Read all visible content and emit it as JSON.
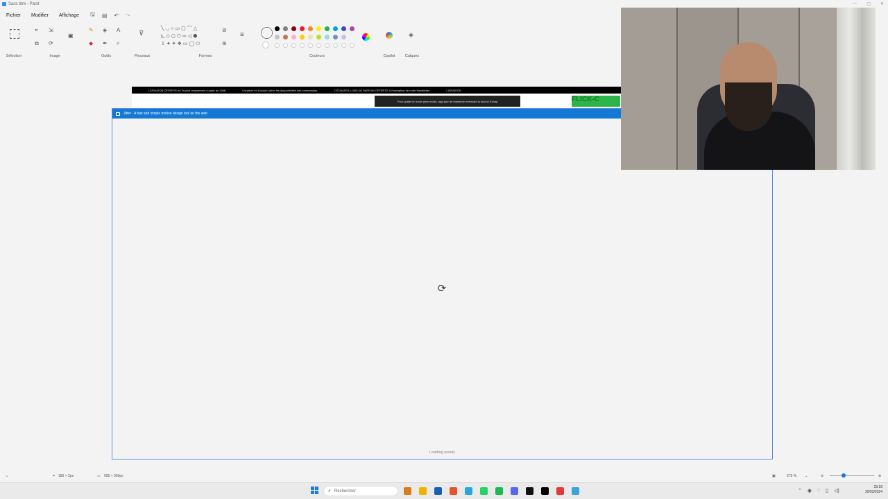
{
  "window": {
    "title": "Sans titre - Paint",
    "controls": [
      "—",
      "▢",
      "✕"
    ]
  },
  "menu": {
    "items": [
      "Fichier",
      "Modifier",
      "Affichage"
    ]
  },
  "ribbon": {
    "groups": [
      "Sélection",
      "Image",
      "Outils",
      "Pinceaux",
      "Formes",
      "Couleurs",
      "Copilot",
      "Calques"
    ],
    "colors_row1": [
      "#000000",
      "#7f7f7f",
      "#880015",
      "#ed1c24",
      "#ff7f27",
      "#fff200",
      "#22b14c",
      "#00a2e8",
      "#3f48cc",
      "#a349a4"
    ],
    "colors_row2": [
      "#c3c3c3",
      "#b97a57",
      "#ffaec9",
      "#ffc90e",
      "#efe4b0",
      "#b5e61d",
      "#99d9ea",
      "#7092be",
      "#c8bfe7"
    ],
    "primary_color": "#000000",
    "accent": "#1478d6"
  },
  "canvas": {
    "banner_text_1": "LIVRAISON OFFERTE en France uniquement à partir de 150€",
    "banner_text_2": "Livraison en Europe: selon les disponibilités des commandes",
    "banner_text_3": "2 ÉCHANTILLONS DE PARFUM OFFERTS à l'inscription de notre Newsletter",
    "banner_text_4": "LIVRAISON",
    "cookie_text": "Pour quitter le mode plein écran, appuyez de maintenir enfoncée la touche Échap",
    "green_text": "FLICK-C"
  },
  "jitter": {
    "window_title": "Jitter - A fast and simple motion design tool on the web",
    "loading_text": "Loading assets"
  },
  "status": {
    "cursor": "186 × 2px",
    "selection": "656 × 369px",
    "zoom": "275 %"
  },
  "taskbar": {
    "search_placeholder": "Rechercher",
    "time": "23:18",
    "date": "20/03/2024",
    "apps": [
      "#d67c1f",
      "#f0b400",
      "#1a5fb4",
      "#e0562c",
      "#27a7e0",
      "#25d366",
      "#1db954",
      "#5865f2",
      "#111111",
      "#000000",
      "#e23a3a",
      "#3aa4dd"
    ]
  }
}
